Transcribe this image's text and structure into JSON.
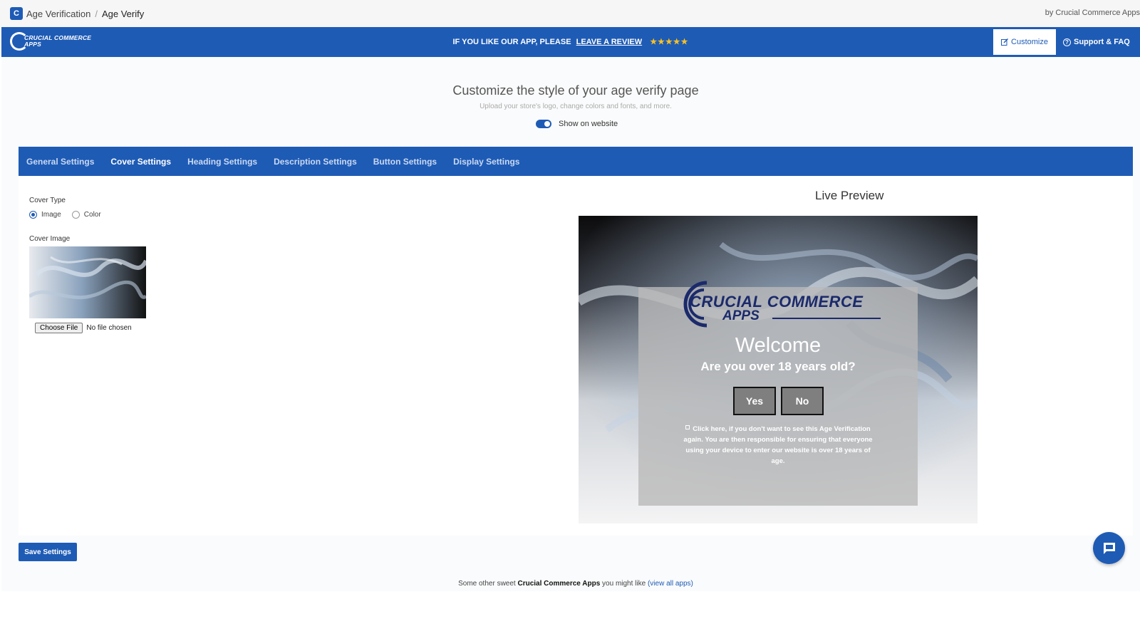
{
  "admin_bar": {
    "breadcrumb_parent": "Age Verification",
    "breadcrumb_separator": "/",
    "breadcrumb_current": "Age Verify",
    "by_text": "by Crucial Commerce Apps"
  },
  "header": {
    "logo_line1": "CRUCIAL COMMERCE",
    "logo_line2": "APPS",
    "review_prefix": "IF YOU LIKE OUR APP, PLEASE",
    "review_link": "LEAVE A REVIEW",
    "stars": "★★★★★",
    "customize_label": "Customize",
    "support_label": "Support & FAQ"
  },
  "page": {
    "title": "Customize the style of your age verify page",
    "subtitle": "Upload your store's logo, change colors and fonts, and more.",
    "toggle_label": "Show on website"
  },
  "tabs": [
    {
      "label": "General Settings"
    },
    {
      "label": "Cover Settings"
    },
    {
      "label": "Heading Settings"
    },
    {
      "label": "Description Settings"
    },
    {
      "label": "Button Settings"
    },
    {
      "label": "Display Settings"
    }
  ],
  "cover": {
    "type_label": "Cover Type",
    "option_image": "Image",
    "option_color": "Color",
    "image_label": "Cover Image",
    "choose_file_label": "Choose File",
    "no_file_text": "No file chosen"
  },
  "preview": {
    "title": "Live Preview",
    "logo_line1": "CRUCIAL COMMERCE",
    "logo_line2": "APPS",
    "welcome": "Welcome",
    "question": "Are you over 18 years old?",
    "yes_label": "Yes",
    "no_label": "No",
    "disclaimer": "Click here, if you don't want to see this Age Verification again. You are then responsible for ensuring that everyone using your device to enter our website is over 18 years of age."
  },
  "actions": {
    "save_label": "Save Settings"
  },
  "footer": {
    "prefix": "Some other sweet",
    "brand": "Crucial Commerce Apps",
    "middle": "you might like",
    "link": "(view all apps)"
  },
  "colors": {
    "brand_blue": "#1e5bb5",
    "star_gold": "#f6c026"
  }
}
